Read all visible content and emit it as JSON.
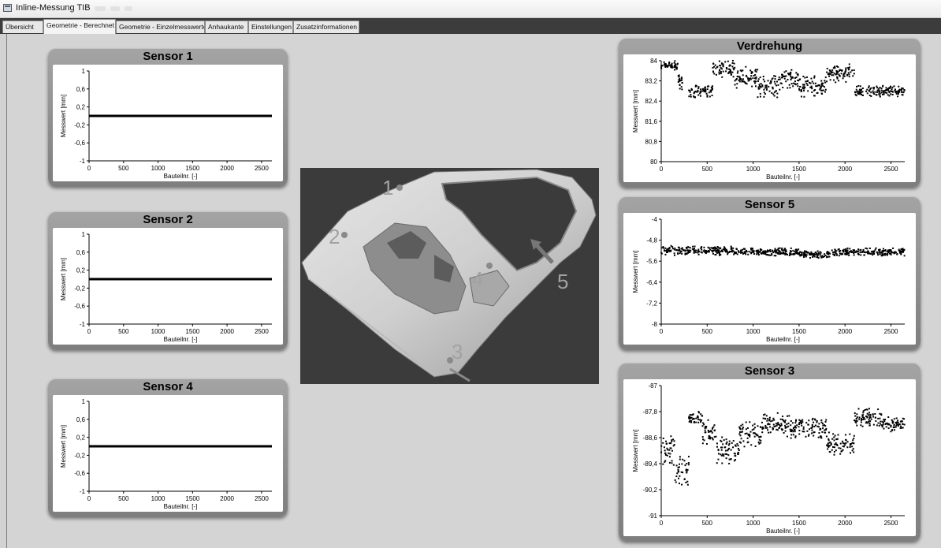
{
  "window": {
    "title": "Inline-Messung TIB"
  },
  "tabs": [
    {
      "label": "Übersicht",
      "active": false
    },
    {
      "label": "Geometrie - Berechnet",
      "active": true
    },
    {
      "label": "Geometrie - Einzelmesswerte",
      "active": false
    },
    {
      "label": "Anhaukante",
      "active": false
    },
    {
      "label": "Einstellungen",
      "active": false
    },
    {
      "label": "Zusatzinformationen",
      "active": false
    }
  ],
  "image": {
    "labels": [
      "1",
      "2",
      "3",
      "4",
      "5"
    ]
  },
  "chart_data": [
    {
      "id": "sensor1",
      "title": "Sensor 1",
      "type": "line",
      "xlabel": "Bauteilnr. [-]",
      "ylabel": "Messwert [mm]",
      "xlim": [
        0,
        2650
      ],
      "xticks": [
        0,
        500,
        1000,
        1500,
        2000,
        2500
      ],
      "ylim": [
        -1,
        1
      ],
      "yticks": [
        1,
        0.6,
        0.2,
        -0.2,
        -0.6,
        -1
      ],
      "ytick_labels": [
        "1",
        "0,6",
        "0,2",
        "-0,2",
        "-0,6",
        "-1"
      ],
      "series": [
        {
          "x": [
            0,
            2650
          ],
          "y": [
            0,
            0
          ]
        }
      ]
    },
    {
      "id": "sensor2",
      "title": "Sensor 2",
      "type": "line",
      "xlabel": "Bauteilnr. [-]",
      "ylabel": "Messwert [mm]",
      "xlim": [
        0,
        2650
      ],
      "xticks": [
        0,
        500,
        1000,
        1500,
        2000,
        2500
      ],
      "ylim": [
        -1,
        1
      ],
      "yticks": [
        1,
        0.6,
        0.2,
        -0.2,
        -0.6,
        -1
      ],
      "ytick_labels": [
        "1",
        "0,6",
        "0,2",
        "-0,2",
        "-0,6",
        "-1"
      ],
      "series": [
        {
          "x": [
            0,
            2650
          ],
          "y": [
            0,
            0
          ]
        }
      ]
    },
    {
      "id": "sensor4",
      "title": "Sensor 4",
      "type": "line",
      "xlabel": "Bauteilnr. [-]",
      "ylabel": "Messwert [mm]",
      "xlim": [
        0,
        2650
      ],
      "xticks": [
        0,
        500,
        1000,
        1500,
        2000,
        2500
      ],
      "ylim": [
        -1,
        1
      ],
      "yticks": [
        1,
        0.6,
        0.2,
        -0.2,
        -0.6,
        -1
      ],
      "ytick_labels": [
        "1",
        "0,6",
        "0,2",
        "-0,2",
        "-0,6",
        "-1"
      ],
      "series": [
        {
          "x": [
            0,
            2650
          ],
          "y": [
            0,
            0
          ]
        }
      ]
    },
    {
      "id": "verdrehung",
      "title": "Verdrehung",
      "type": "scatter",
      "xlabel": "Bauteilnr. [-]",
      "ylabel": "Messwert [mm]",
      "xlim": [
        0,
        2650
      ],
      "xticks": [
        0,
        500,
        1000,
        1500,
        2000,
        2500
      ],
      "ylim": [
        80,
        84
      ],
      "yticks": [
        84,
        83.2,
        82.4,
        81.6,
        80.8,
        80
      ],
      "ytick_labels": [
        "84",
        "83,2",
        "82,4",
        "81,6",
        "80,8",
        "80"
      ],
      "segments": [
        {
          "x": [
            0,
            180
          ],
          "y": 83.8,
          "spread": 0.15
        },
        {
          "x": 180,
          "y": 83.2,
          "spread": 0.25
        },
        {
          "x": [
            300,
            560
          ],
          "y": 82.8,
          "spread": 0.2
        },
        {
          "x": [
            560,
            800
          ],
          "y": 83.7,
          "spread": 0.25
        },
        {
          "x": [
            800,
            1050
          ],
          "y": 83.3,
          "spread": 0.3
        },
        {
          "x": [
            1050,
            1300
          ],
          "y": 83.0,
          "spread": 0.3
        },
        {
          "x": [
            1300,
            1500
          ],
          "y": 83.3,
          "spread": 0.3
        },
        {
          "x": [
            1500,
            1800
          ],
          "y": 83.0,
          "spread": 0.3
        },
        {
          "x": [
            1800,
            2100
          ],
          "y": 83.5,
          "spread": 0.25
        },
        {
          "x": [
            2100,
            2650
          ],
          "y": 82.8,
          "spread": 0.15
        }
      ]
    },
    {
      "id": "sensor5",
      "title": "Sensor 5",
      "type": "scatter",
      "xlabel": "Bauteilnr. [-]",
      "ylabel": "Messwert [mm]",
      "xlim": [
        0,
        2650
      ],
      "xticks": [
        0,
        500,
        1000,
        1500,
        2000,
        2500
      ],
      "ylim": [
        -8,
        -4
      ],
      "yticks": [
        -4,
        -4.8,
        -5.6,
        -6.4,
        -7.2,
        -8
      ],
      "ytick_labels": [
        "-4",
        "-4,8",
        "-5,6",
        "-6,4",
        "-7,2",
        "-8"
      ],
      "segments": [
        {
          "x": [
            0,
            800
          ],
          "y": -5.2,
          "spread": 0.12
        },
        {
          "x": [
            800,
            1500
          ],
          "y": -5.25,
          "spread": 0.1
        },
        {
          "x": [
            1500,
            1850
          ],
          "y": -5.35,
          "spread": 0.1
        },
        {
          "x": [
            1850,
            2650
          ],
          "y": -5.25,
          "spread": 0.1
        }
      ]
    },
    {
      "id": "sensor3",
      "title": "Sensor 3",
      "type": "scatter",
      "xlabel": "Bauteilnr. [-]",
      "ylabel": "Messwert [mm]",
      "xlim": [
        0,
        2650
      ],
      "xticks": [
        0,
        500,
        1000,
        1500,
        2000,
        2500
      ],
      "ylim": [
        -91,
        -87
      ],
      "yticks": [
        -87,
        -87.8,
        -88.6,
        -89.4,
        -90.2,
        -91
      ],
      "ytick_labels": [
        "-87",
        "-87,8",
        "-88,6",
        "-89,4",
        "-90,2",
        "-91"
      ],
      "segments": [
        {
          "x": [
            0,
            150
          ],
          "y": -89.0,
          "spread": 0.35
        },
        {
          "x": [
            150,
            300
          ],
          "y": -89.6,
          "spread": 0.35
        },
        {
          "x": [
            300,
            450
          ],
          "y": -88.0,
          "spread": 0.15
        },
        {
          "x": [
            450,
            600
          ],
          "y": -88.4,
          "spread": 0.3
        },
        {
          "x": [
            600,
            850
          ],
          "y": -89.0,
          "spread": 0.3
        },
        {
          "x": [
            850,
            1100
          ],
          "y": -88.5,
          "spread": 0.3
        },
        {
          "x": [
            1100,
            1400
          ],
          "y": -88.2,
          "spread": 0.25
        },
        {
          "x": [
            1400,
            1800
          ],
          "y": -88.3,
          "spread": 0.25
        },
        {
          "x": [
            1800,
            2100
          ],
          "y": -88.8,
          "spread": 0.25
        },
        {
          "x": [
            2100,
            2400
          ],
          "y": -88.0,
          "spread": 0.2
        },
        {
          "x": [
            2400,
            2650
          ],
          "y": -88.2,
          "spread": 0.15
        }
      ]
    }
  ]
}
